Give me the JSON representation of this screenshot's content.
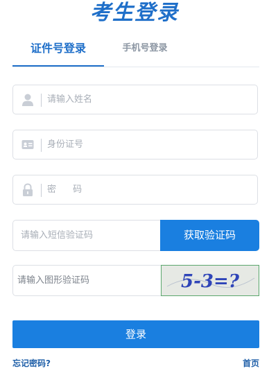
{
  "page_title": "考生登录",
  "tabs": [
    {
      "label": "证件号登录",
      "active": true
    },
    {
      "label": "手机号登录",
      "active": false
    }
  ],
  "fields": {
    "name": {
      "placeholder": "请输入姓名",
      "icon": "user-icon"
    },
    "id_number": {
      "placeholder": "身份证号",
      "icon": "id-card-icon"
    },
    "password": {
      "placeholder": "密 码",
      "icon": "lock-icon"
    }
  },
  "sms": {
    "placeholder": "请输入短信验证码",
    "button_label": "获取验证码"
  },
  "captcha": {
    "placeholder": "请输入图形验证码",
    "image_text": "5-3=?"
  },
  "login_button": "登录",
  "links": {
    "forgot_password": "忘记密码?",
    "home": "首页"
  },
  "colors": {
    "primary": "#1a7fe0",
    "title": "#1f6fc9",
    "link": "#1f5fa8"
  }
}
